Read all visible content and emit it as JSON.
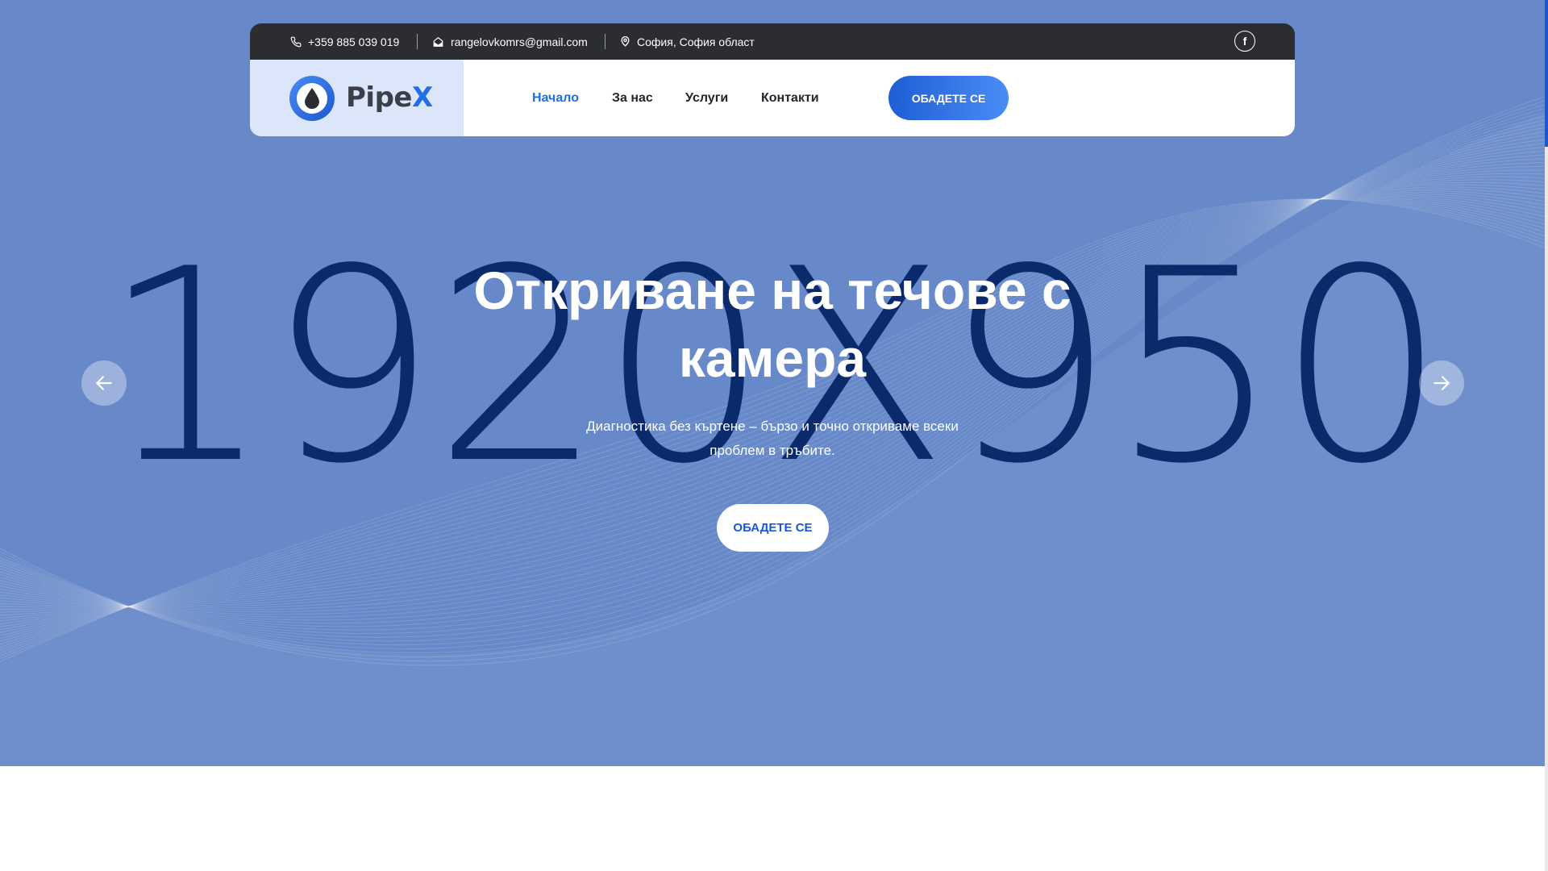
{
  "topbar": {
    "phone": "+359 885 039 019",
    "email": "rangelovkomrs@gmail.com",
    "location": "София, София област",
    "social_icon": "facebook-icon"
  },
  "logo": {
    "text_main": "Pipe",
    "text_accent": "X"
  },
  "nav": {
    "items": [
      "Начало",
      "За нас",
      "Услуги",
      "Контакти"
    ],
    "active": "Начало",
    "cta_label": "ОБАДЕТЕ СЕ"
  },
  "hero": {
    "placeholder": "1920X950",
    "title_line1": "Откриване на течове с",
    "title_line2": "камера",
    "subtitle_line1": "Диагностика без къртене – бързо и точно откриваме всеки",
    "subtitle_line2": "проблем в тръбите.",
    "cta_label": "ОБАДЕТЕ СЕ",
    "prev_icon": "arrow-left-icon",
    "next_icon": "arrow-right-icon"
  },
  "colors": {
    "hero_bg": "#6789c9",
    "accent": "#1f6fe5",
    "topbar_bg": "#2b2d31",
    "placeholder_text": "#0b2a6b"
  }
}
